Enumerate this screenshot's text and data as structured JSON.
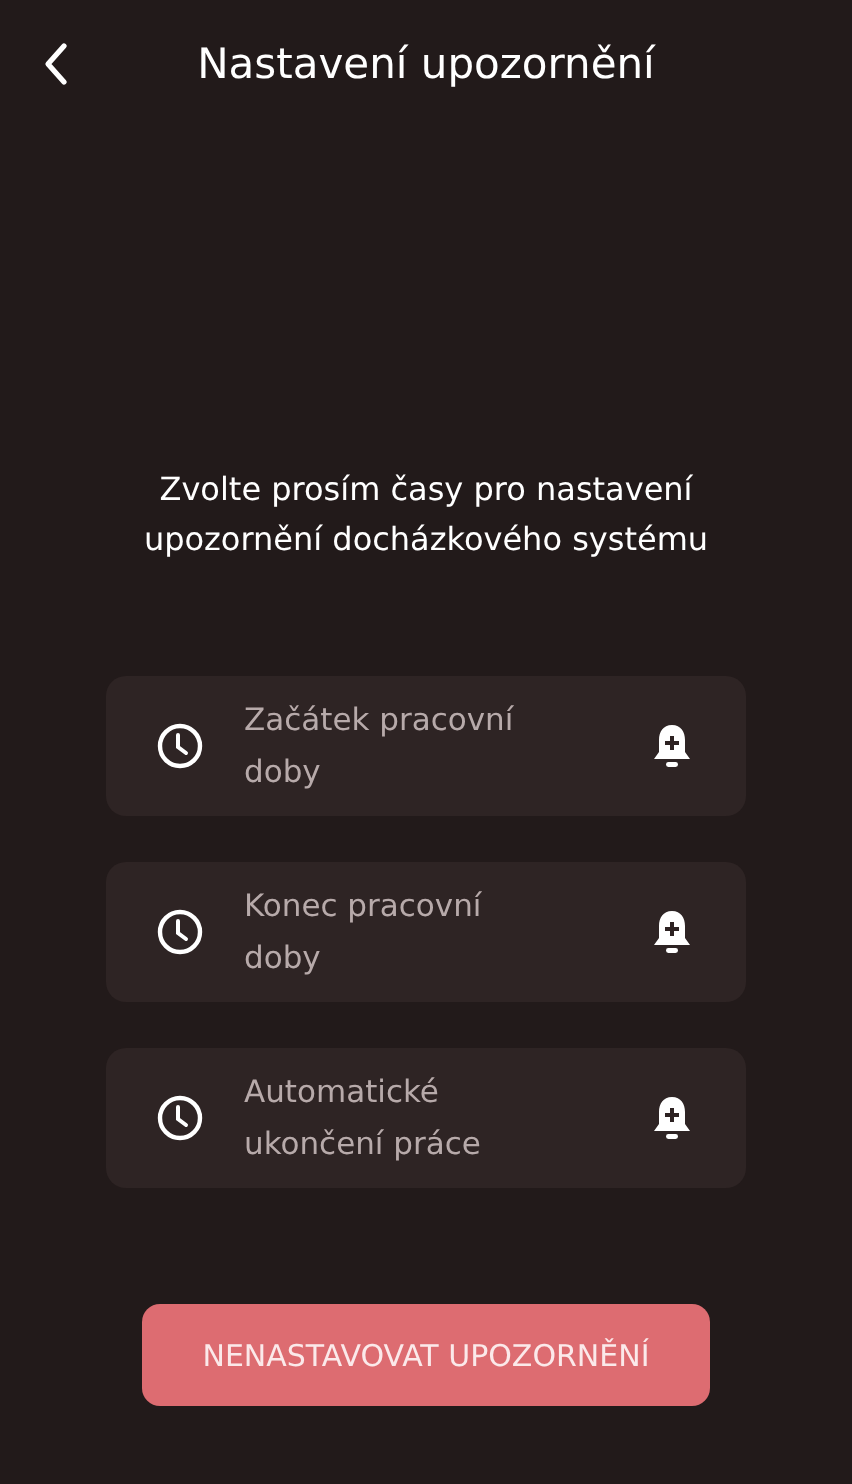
{
  "header": {
    "title": "Nastavení upozornění"
  },
  "description": "Zvolte prosím časy pro nastavení upozornění docházkového systému",
  "reminders": [
    {
      "label": "Začátek pracovní doby"
    },
    {
      "label": "Konec pracovní doby"
    },
    {
      "label": "Automatické ukončení práce"
    }
  ],
  "skip_button": "NENASTAVOVAT UPOZORNĚNÍ"
}
